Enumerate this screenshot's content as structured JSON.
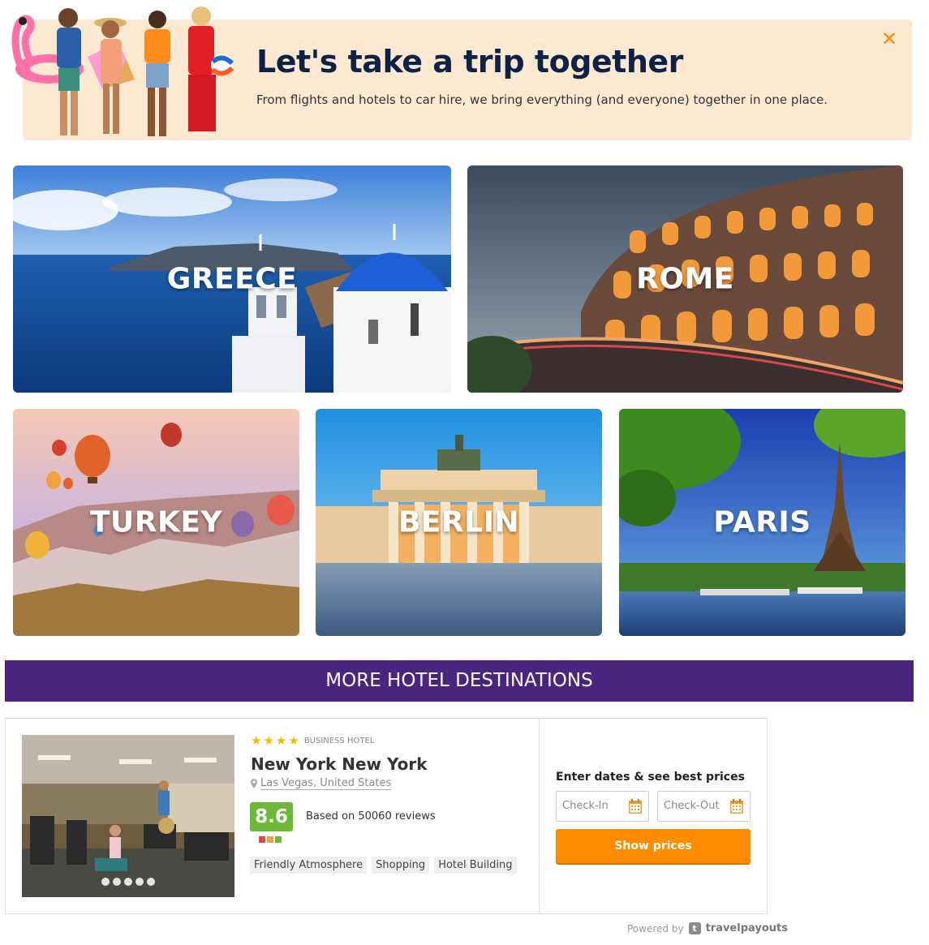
{
  "banner": {
    "title": "Let's take a trip together",
    "subtitle": "From flights and hotels to car hire, we bring everything (and everyone) together in one place.",
    "close_glyph": "✕"
  },
  "destinations": [
    {
      "label": "GREECE"
    },
    {
      "label": "ROME"
    },
    {
      "label": "TURKEY"
    },
    {
      "label": "BERLIN"
    },
    {
      "label": "PARIS"
    }
  ],
  "section": {
    "title": "MORE HOTEL DESTINATIONS"
  },
  "hotel": {
    "stars": 4,
    "type": "BUSINESS HOTEL",
    "name": "New York New York",
    "location": "Las Vegas, United States",
    "score": "8.6",
    "reviews": "Based on 50060 reviews",
    "tags": [
      "Friendly Atmosphere",
      "Shopping",
      "Hotel Building"
    ],
    "photo_count": 5,
    "dates_label": "Enter dates & see best prices",
    "checkin_placeholder": "Check-In",
    "checkout_placeholder": "Check-Out",
    "cta_label": "Show prices"
  },
  "footer": {
    "powered_by": "Powered by",
    "brand": "travelpayouts",
    "brand_icon": "t"
  },
  "colors": {
    "banner_bg": "#fde9d2",
    "banner_title": "#0d2244",
    "accent_orange": "#ff8c00",
    "section_purple": "#4a2580",
    "score_green": "#6bb936",
    "star_yellow": "#f5b800"
  }
}
